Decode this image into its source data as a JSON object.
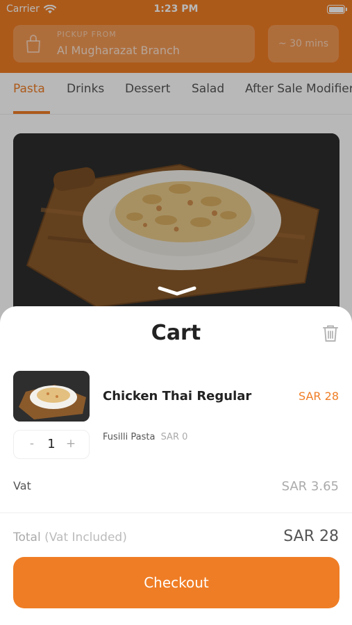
{
  "status_bar": {
    "carrier": "Carrier",
    "time": "1:23 PM"
  },
  "header": {
    "pickup_caption": "PICKUP FROM",
    "branch": "Al Mugharazat Branch",
    "eta": "~ 30 mins"
  },
  "tabs": [
    {
      "label": "Pasta",
      "active": true
    },
    {
      "label": "Drinks",
      "active": false
    },
    {
      "label": "Dessert",
      "active": false
    },
    {
      "label": "Salad",
      "active": false
    },
    {
      "label": "After Sale Modifiers",
      "active": false
    }
  ],
  "cart": {
    "title": "Cart",
    "items": [
      {
        "name": "Chicken Thai Regular",
        "price": "SAR 28",
        "quantity": "1",
        "modifier": {
          "name": "Fusilli Pasta",
          "price": "SAR 0"
        }
      }
    ],
    "stepper": {
      "minus": "-",
      "plus": "+"
    },
    "vat_label": "Vat",
    "vat_value": "SAR 3.65",
    "total_label": "Total",
    "total_sublabel": "(Vat Included)",
    "total_value": "SAR 28",
    "checkout_label": "Checkout"
  },
  "colors": {
    "accent": "#ef7d25",
    "text_dark": "#222222",
    "text_muted": "#aaaaaa"
  },
  "icons": [
    "wifi-icon",
    "battery-icon",
    "shopping-bag-icon",
    "chevron-down-icon",
    "trash-icon"
  ]
}
